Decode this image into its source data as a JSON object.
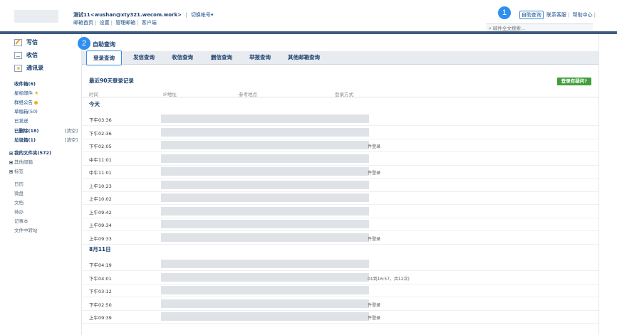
{
  "header": {
    "account": "测试11<wushan@xty321.wecom.work>",
    "switch_account": "切换帐号",
    "sublinks": [
      "邮箱首页",
      "设置",
      "管理邮箱",
      "客户端"
    ],
    "toplinks": [
      "自助查询",
      "联系客服",
      "帮助中心"
    ],
    "search_placeholder": "邮件全文搜索..."
  },
  "markers": [
    "1",
    "2"
  ],
  "sidebar": {
    "write": "写信",
    "inbox_btn": "收信",
    "contacts": "通讯录",
    "folders": [
      {
        "label": "收件箱(6)",
        "bold": true
      },
      {
        "label": "星标邮件"
      },
      {
        "label": "群组公告"
      },
      {
        "label": "草稿箱(50)"
      },
      {
        "label": "已发送"
      },
      {
        "label": "已删除(18)",
        "bold": true,
        "action": "[清空]"
      },
      {
        "label": "垃圾箱(1)",
        "bold": true,
        "action": "[清空]"
      }
    ],
    "tree": [
      "我的文件夹(572)",
      "其他邮箱",
      "标签"
    ],
    "tools": [
      "日历",
      "微盘",
      "文档",
      "待办",
      "记事本",
      "文件中转站"
    ]
  },
  "main": {
    "title": "自助查询",
    "tabs": [
      "登录查询",
      "发信查询",
      "收信查询",
      "删信查询",
      "举报查询",
      "其他邮箱查询"
    ],
    "section_title": "最近90天登录记录",
    "report_button": "登录有疑问?",
    "columns": [
      "时间",
      "IP地址",
      "参考地点",
      "登录方式"
    ],
    "groups": [
      {
        "label": "今天",
        "rows": [
          {
            "time": "下午03:36",
            "tail": ""
          },
          {
            "time": "下午02:36",
            "tail": ""
          },
          {
            "time": "下午02:05",
            "tail": "件登录"
          },
          {
            "time": "中午11:01",
            "tail": ""
          },
          {
            "time": "中午11:01",
            "tail": "件登录"
          },
          {
            "time": "上午10:23",
            "tail": ""
          },
          {
            "time": "上午10:02",
            "tail": ""
          },
          {
            "time": "上午09:42",
            "tail": ""
          },
          {
            "time": "上午09:34",
            "tail": ""
          },
          {
            "time": "上午09:33",
            "tail": "件登录"
          }
        ]
      },
      {
        "label": "8月11日",
        "rows": [
          {
            "time": "下午04:19",
            "tail": ""
          },
          {
            "time": "下午04:01",
            "tail": "01到16:57，共12次)"
          },
          {
            "time": "下午03:12",
            "tail": ""
          },
          {
            "time": "下午02:50",
            "tail": "件登录"
          },
          {
            "time": "上午09:39",
            "tail": "件登录"
          }
        ]
      }
    ]
  }
}
